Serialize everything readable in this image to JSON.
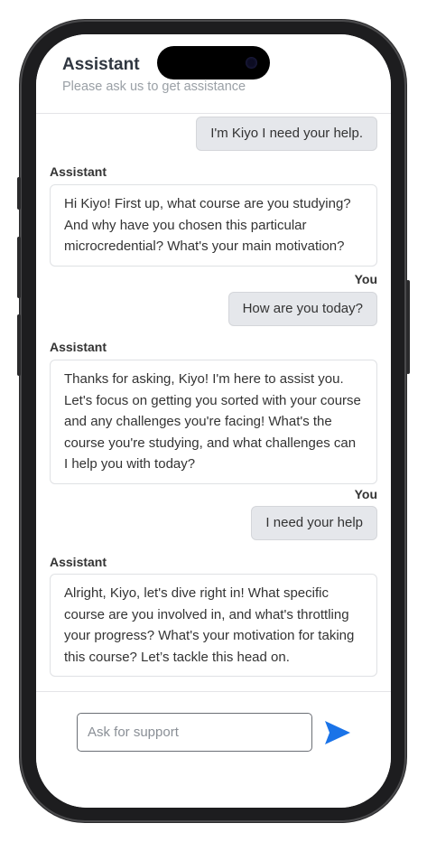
{
  "header": {
    "title": "Assistant",
    "subtitle": "Please ask us to get assistance"
  },
  "messages": [
    {
      "role": "user",
      "sender": "",
      "text": "I'm Kiyo I need your help."
    },
    {
      "role": "assistant",
      "sender": "Assistant",
      "text": "Hi Kiyo! First up, what course are you studying? And why have you chosen this particular microcredential? What's your main motivation?"
    },
    {
      "role": "user",
      "sender": "You",
      "text": "How are you today?"
    },
    {
      "role": "assistant",
      "sender": "Assistant",
      "text": "Thanks for asking, Kiyo! I'm here to assist you. Let's focus on getting you sorted with your course and any challenges you're facing! What's the course you're studying, and what challenges can I help you with today?"
    },
    {
      "role": "user",
      "sender": "You",
      "text": "I need your help"
    },
    {
      "role": "assistant",
      "sender": "Assistant",
      "text": "Alright, Kiyo, let's dive right in! What specific course are you involved in, and what's throttling your progress? What's your motivation for taking this course? Let’s tackle this head on."
    }
  ],
  "composer": {
    "placeholder": "Ask for support",
    "value": "",
    "send_icon": "send-arrow-icon"
  },
  "colors": {
    "accent": "#1a73e8",
    "user_bubble": "#e5e7eb",
    "text": "#333333"
  }
}
